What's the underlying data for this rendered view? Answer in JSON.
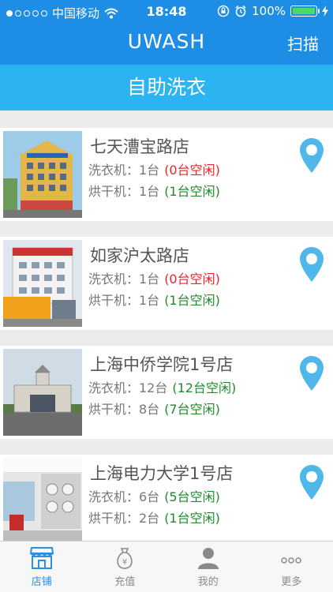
{
  "status_bar": {
    "carrier": "中国移动",
    "time": "18:48",
    "battery": "100%"
  },
  "nav": {
    "title": "UWASH",
    "scan_label": "扫描"
  },
  "subheader": {
    "title": "自助洗衣"
  },
  "stores": [
    {
      "name": "七天漕宝路店",
      "washer": "洗衣机：1台",
      "washer_free": "(0台空闲)",
      "dryer": "烘干机：1台",
      "dryer_free": "(1台空闲)"
    },
    {
      "name": "如家沪太路店",
      "washer": "洗衣机：1台",
      "washer_free": "(0台空闲)",
      "dryer": "烘干机：1台",
      "dryer_free": "(1台空闲)"
    },
    {
      "name": "上海中侨学院1号店",
      "washer": "洗衣机：12台",
      "washer_free": "(12台空闲)",
      "dryer": "烘干机：8台",
      "dryer_free": "(7台空闲)"
    },
    {
      "name": "上海电力大学1号店",
      "washer": "洗衣机：6台",
      "washer_free": "(5台空闲)",
      "dryer": "烘干机：2台",
      "dryer_free": "(1台空闲)"
    }
  ],
  "tabs": [
    {
      "label": "店铺",
      "icon": "store-icon",
      "active": true
    },
    {
      "label": "充值",
      "icon": "money-bag-icon",
      "active": false
    },
    {
      "label": "我的",
      "icon": "user-icon",
      "active": false
    },
    {
      "label": "更多",
      "icon": "more-icon",
      "active": false
    }
  ],
  "colors": {
    "nav_bg": "#1e8de6",
    "subheader_bg": "#2bb3f2",
    "busy_red": "#e8262a",
    "free_green": "#1f8a2c",
    "pin_blue": "#4fb7ea"
  }
}
